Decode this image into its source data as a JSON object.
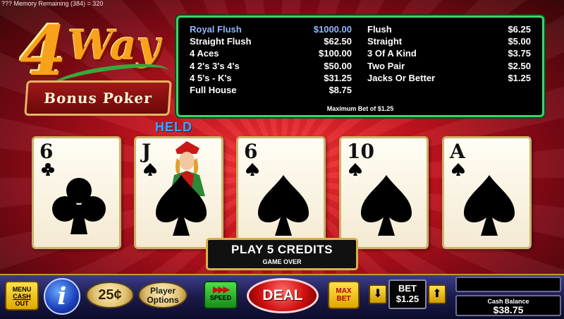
{
  "status_line": "??? Memory Remaining (384) = 320",
  "logo": {
    "main": "4",
    "sub": "Way",
    "banner": "Bonus Poker"
  },
  "paytable": {
    "left": [
      {
        "hand": "Royal Flush",
        "pay": "$1000.00"
      },
      {
        "hand": "Straight Flush",
        "pay": "$62.50"
      },
      {
        "hand": "4 Aces",
        "pay": "$100.00"
      },
      {
        "hand": "4 2's 3's 4's",
        "pay": "$50.00"
      },
      {
        "hand": "4 5's - K's",
        "pay": "$31.25"
      },
      {
        "hand": "Full House",
        "pay": "$8.75"
      }
    ],
    "right": [
      {
        "hand": "Flush",
        "pay": "$6.25"
      },
      {
        "hand": "Straight",
        "pay": "$5.00"
      },
      {
        "hand": "3 Of A Kind",
        "pay": "$3.75"
      },
      {
        "hand": "Two Pair",
        "pay": "$2.50"
      },
      {
        "hand": "Jacks Or Better",
        "pay": "$1.25"
      }
    ],
    "max_bet_text": "Maximum Bet of $1.25"
  },
  "held_label": "HELD",
  "cards": [
    {
      "rank": "6",
      "suit": "club-icon",
      "held": false
    },
    {
      "rank": "J",
      "suit": "spade-icon",
      "held": true
    },
    {
      "rank": "6",
      "suit": "spade-icon",
      "held": false
    },
    {
      "rank": "10",
      "suit": "spade-icon",
      "held": false
    },
    {
      "rank": "A",
      "suit": "spade-icon",
      "held": false
    }
  ],
  "play_box": {
    "line1": "PLAY 5 CREDITS",
    "line2": "GAME OVER"
  },
  "buttons": {
    "menu": [
      "MENU",
      "CASH",
      "OUT"
    ],
    "info": "i",
    "denomination": "25¢",
    "options": [
      "Player",
      "Options"
    ],
    "speed": "SPEED",
    "deal": "DEAL",
    "max_bet": [
      "MAX",
      "BET"
    ],
    "bet_down_icon": "arrow-down-icon",
    "bet_up_icon": "arrow-up-icon"
  },
  "bet": {
    "label": "BET",
    "value": "$1.25"
  },
  "cash_balance": {
    "label": "Cash Balance",
    "value": "$38.75"
  },
  "colors": {
    "paytable_border": "#3cd36a",
    "held": "#3aa6ff",
    "highlight_row": "#8fb8ff"
  }
}
